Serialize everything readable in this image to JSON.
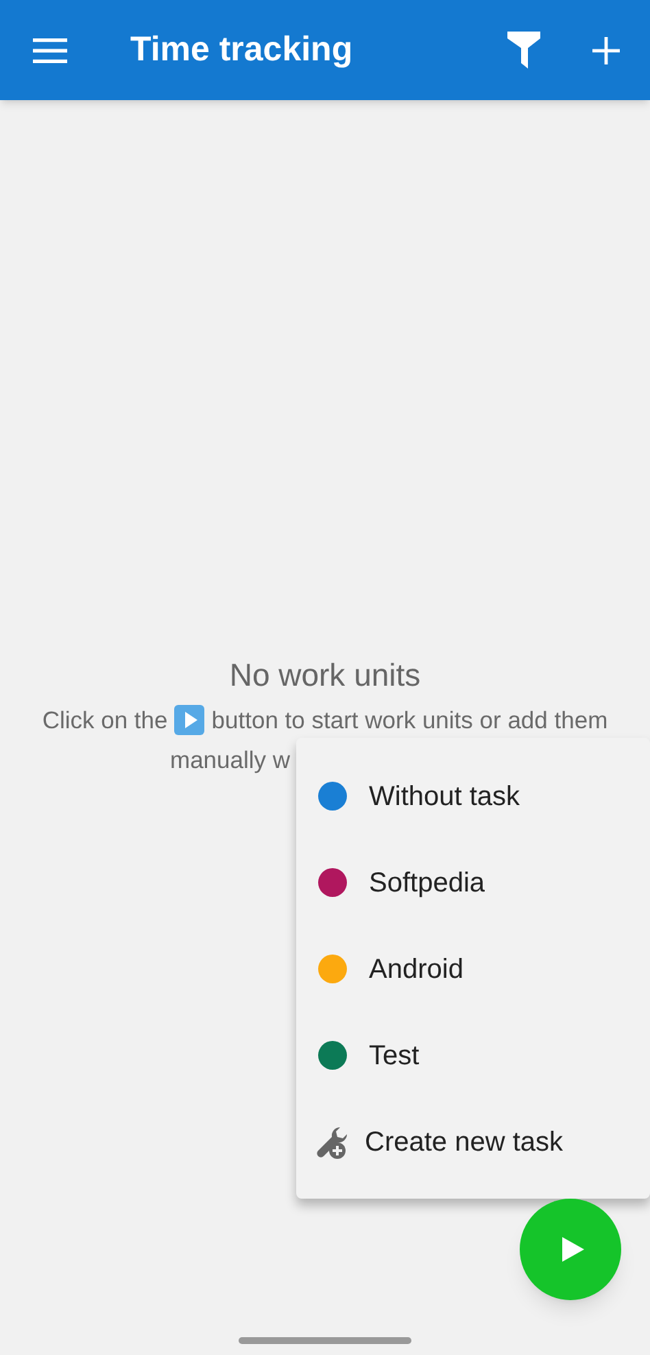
{
  "app_bar": {
    "title": "Time tracking"
  },
  "empty_state": {
    "title": "No work units",
    "hint_before": "Click on the",
    "hint_after": "button to start work units or add them",
    "hint_line_2": "manually w"
  },
  "task_menu": {
    "items": [
      {
        "kind": "task",
        "label": "Without task",
        "color": "#1a7fd4"
      },
      {
        "kind": "task",
        "label": "Softpedia",
        "color": "#b0175e"
      },
      {
        "kind": "task",
        "label": "Android",
        "color": "#fca90f"
      },
      {
        "kind": "task",
        "label": "Test",
        "color": "#0c7a56"
      },
      {
        "kind": "create",
        "label": "Create new task"
      }
    ]
  }
}
